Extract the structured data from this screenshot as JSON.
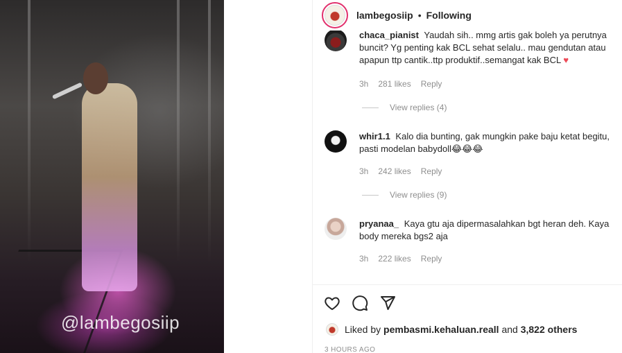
{
  "post": {
    "watermark": "@lambegosiip"
  },
  "header": {
    "username": "lambegosiip",
    "separator": "•",
    "follow_status": "Following"
  },
  "comments": [
    {
      "handle": "chaca_pianist",
      "text": "Yaudah sih.. mmg artis gak boleh ya perutnya buncit? Yg penting kak BCL sehat selalu.. mau gendutan atau apapun ttp cantik..ttp produktif..semangat kak BCL",
      "emoji": "♥",
      "time": "3h",
      "likes": "281 likes",
      "reply": "Reply",
      "view_replies": "View replies (4)"
    },
    {
      "handle": "whir1.1",
      "text": "Kalo dia bunting, gak mungkin pake baju ketat begitu, pasti modelan babydoll",
      "emoji": "😂😂😂",
      "time": "3h",
      "likes": "242 likes",
      "reply": "Reply",
      "view_replies": "View replies (9)"
    },
    {
      "handle": "pryanaa_",
      "text": "Kaya gtu aja dipermasalahkan bgt heran deh. Kaya body mereka bgs2 aja",
      "time": "3h",
      "likes": "222 likes",
      "reply": "Reply"
    }
  ],
  "footer": {
    "liked_prefix": "Liked by",
    "liked_user": "pembasmi.kehaluan.reall",
    "liked_and": "and",
    "liked_others": "3,822 others",
    "timestamp": "3 HOURS AGO"
  },
  "icons": {
    "like": "heart-outline-icon",
    "comment": "speech-bubble-icon",
    "share": "paper-plane-icon"
  },
  "colors": {
    "text": "#262626",
    "muted": "#8e8e8e",
    "heart": "#ed4956"
  }
}
